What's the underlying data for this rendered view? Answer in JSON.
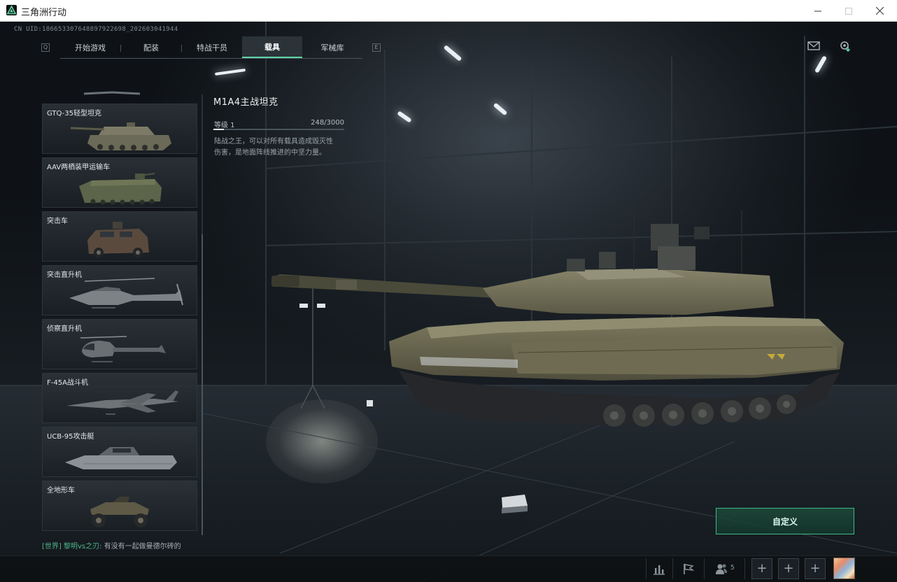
{
  "window": {
    "title": "三角洲行动"
  },
  "uid": "CN UID:186653307648897922698_202603041944",
  "nav": {
    "tabs": [
      {
        "label": "开始游戏",
        "active": false
      },
      {
        "label": "配装",
        "active": false
      },
      {
        "label": "特战干员",
        "active": false
      },
      {
        "label": "载具",
        "active": true
      },
      {
        "label": "军械库",
        "active": false
      }
    ],
    "left_key": "Q",
    "right_key": "E"
  },
  "vehicles": [
    {
      "name": "GTQ-35轻型坦克",
      "kind": "light-tank"
    },
    {
      "name": "AAV两栖装甲运输车",
      "kind": "amphibious-apc"
    },
    {
      "name": "突击车",
      "kind": "assault-vehicle"
    },
    {
      "name": "突击直升机",
      "kind": "attack-helicopter"
    },
    {
      "name": "侦察直升机",
      "kind": "scout-helicopter"
    },
    {
      "name": "F-45A战斗机",
      "kind": "fighter-jet"
    },
    {
      "name": "UCB-95攻击艇",
      "kind": "attack-boat"
    },
    {
      "name": "全地形车",
      "kind": "atv"
    }
  ],
  "selected_vehicle": {
    "title": "M1A4主战坦克",
    "level_label": "等级 1",
    "xp_text": "248/3000",
    "xp_current": 248,
    "xp_max": 3000,
    "description": "陆战之王，可以对所有载具造成毁灭性伤害，是地面阵线推进的中坚力量。"
  },
  "customize_label": "自定义",
  "chat": {
    "channel": "[世界]",
    "sender": "黎明vs之刃:",
    "message": "有没有一起做曼德尔砖的"
  },
  "bottom": {
    "friends_count": "5",
    "add_slot_label": "+"
  },
  "colors": {
    "accent": "#5fd6a6",
    "button_border": "#3fb98a",
    "chat_channel": "#4fb58a"
  },
  "icons": {
    "mail": "mail-icon",
    "download_settings": "settings-download-icon",
    "stats": "bar-chart-icon",
    "flag": "flag-icon",
    "friends": "friends-icon"
  }
}
